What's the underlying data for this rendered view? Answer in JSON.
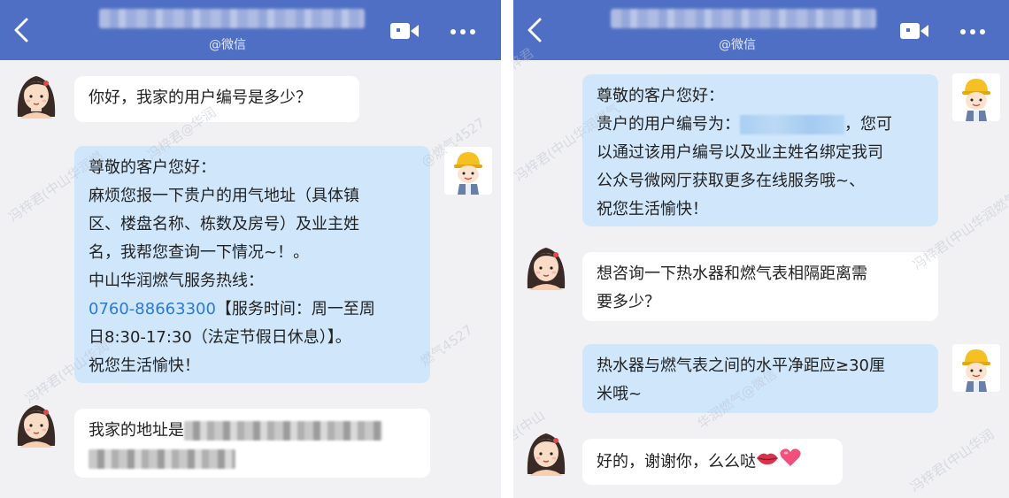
{
  "left": {
    "header": {
      "subtitle": "@微信"
    },
    "messages": [
      {
        "lines": [
          "你好，我家的用户编号是多少？"
        ]
      },
      {
        "lines": [
          "尊敬的客户您好：",
          "麻烦您报一下贵户的用气地址（具体镇",
          "区、楼盘名称、栋数及房号）及业主姓",
          "名，我帮您查询一下情况~！。",
          "中山华润燃气服务热线："
        ],
        "phone": "0760-88663300",
        "phone_tail": "【服务时间：周一至周",
        "tail_lines": [
          "日8:30-17:30（法定节假日休息）】。",
          "祝您生活愉快！"
        ]
      },
      {
        "prefix": "我家的地址是"
      }
    ]
  },
  "right": {
    "header": {
      "subtitle": "@微信"
    },
    "messages": [
      {
        "line1": "尊敬的客户您好：",
        "line2_prefix": "贵户的用户编号为：",
        "line2_suffix": "，您可",
        "lines": [
          "以通过该用户编号以及业主姓名绑定我司",
          "公众号微网厅获取更多在线服务哦~、",
          "祝您生活愉快！"
        ]
      },
      {
        "lines": [
          "想咨询一下热水器和燃气表相隔距离需",
          "要多少？"
        ]
      },
      {
        "lines": [
          "热水器与燃气表之间的水平净距应≥30厘",
          "米哦~"
        ]
      },
      {
        "text": "好的，谢谢你，么么哒"
      }
    ]
  },
  "watermarks": [
    "冯梓君(中山华润燃",
    "冯梓君(中山华润燃气",
    "冯梓君@华润",
    "@燃气4527",
    "冯梓君(中山华润燃气",
    "冯梓君(中山华润",
    "燃气4527",
    "冯梓君(中山",
    "冯梓君(中山华润",
    "华润燃气@微信",
    "冯梓君"
  ],
  "icons": [
    "back-arrow-icon",
    "video-call-icon",
    "more-icon",
    "lips-emoji",
    "heart-emoji"
  ],
  "colors": {
    "header": "#4f6fc4",
    "bubble_blue": "#cfe6fb",
    "bubble_white": "#ffffff",
    "background": "#f1f1f4",
    "link": "#2b7ad6"
  }
}
